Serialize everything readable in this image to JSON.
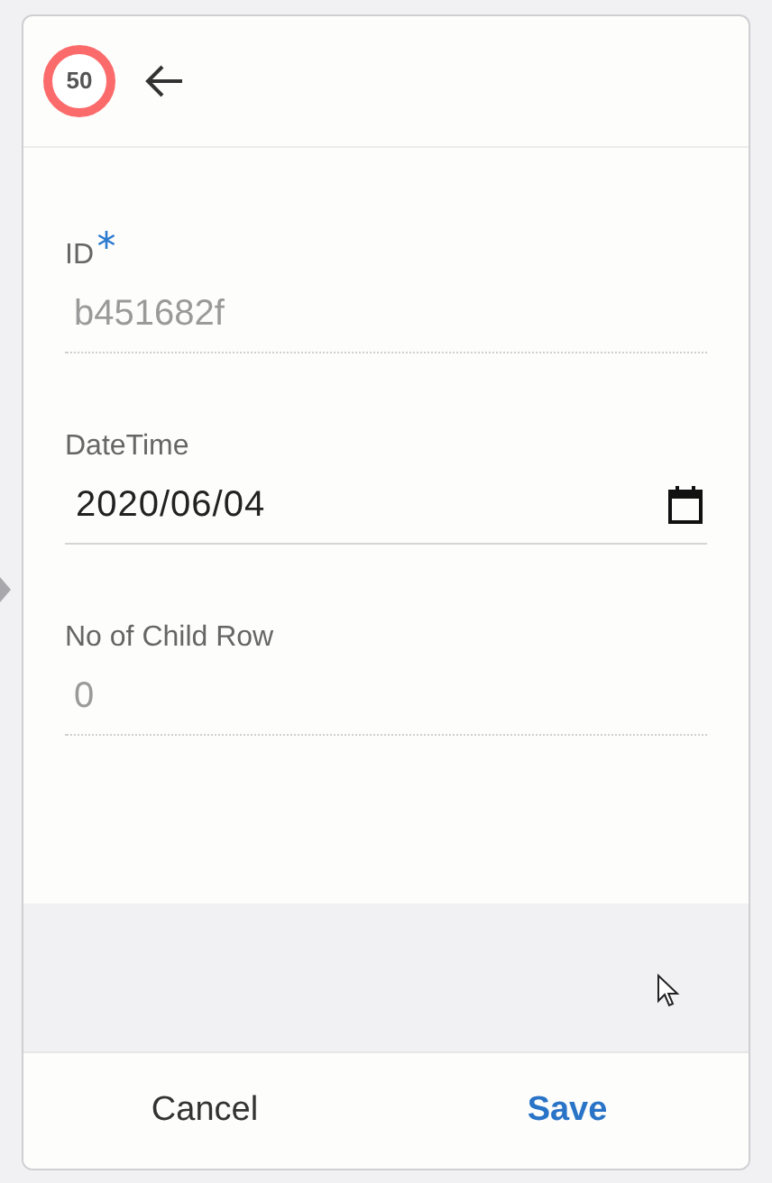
{
  "header": {
    "logo_text": "50"
  },
  "fields": [
    {
      "kind": "readonly",
      "label": "ID",
      "required": true,
      "value": "b451682f"
    },
    {
      "kind": "date",
      "label": "DateTime",
      "required": false,
      "value": "2020/06/04"
    },
    {
      "kind": "readonly",
      "label": "No of Child Row",
      "required": false,
      "value": "0"
    }
  ],
  "buttons": [
    {
      "label": "Cancel",
      "primary": false
    },
    {
      "label": "Save",
      "primary": true
    }
  ]
}
